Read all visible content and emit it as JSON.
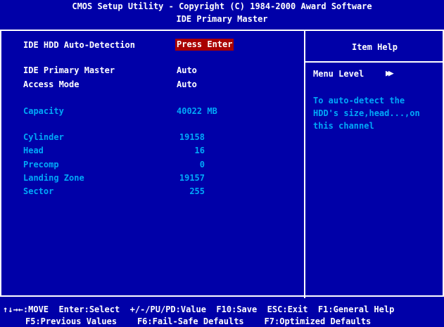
{
  "header": {
    "line1": "CMOS Setup Utility - Copyright (C) 1984-2000 Award Software",
    "line2": "IDE Primary Master"
  },
  "settings": {
    "autodetect": {
      "label": "IDE HDD Auto-Detection",
      "value": "Press Enter"
    },
    "primary_master": {
      "label": "IDE Primary Master",
      "value": "Auto"
    },
    "access_mode": {
      "label": "Access Mode",
      "value": "Auto"
    },
    "capacity": {
      "label": "Capacity",
      "value": "40022 MB"
    },
    "cylinder": {
      "label": "Cylinder",
      "value": "19158"
    },
    "head": {
      "label": "Head",
      "value": "16"
    },
    "precomp": {
      "label": "Precomp",
      "value": "0"
    },
    "landing_zone": {
      "label": "Landing Zone",
      "value": "19157"
    },
    "sector": {
      "label": "Sector",
      "value": "255"
    }
  },
  "item_help": {
    "title": "Item Help",
    "menu_level_label": "Menu Level",
    "menu_level_icon": "double-right-arrow",
    "lines": [
      "To auto-detect the",
      "HDD's size,head...,on",
      "this channel"
    ]
  },
  "footer": {
    "line1": "↑↓→←:MOVE  Enter:Select  +/-/PU/PD:Value  F10:Save  ESC:Exit  F1:General Help",
    "line2": "F5:Previous Values    F6:Fail-Safe Defaults    F7:Optimized Defaults"
  },
  "colors": {
    "background": "#0000a8",
    "text": "#ffffff",
    "dim_text": "#00a8f8",
    "highlight": "#a80000"
  }
}
